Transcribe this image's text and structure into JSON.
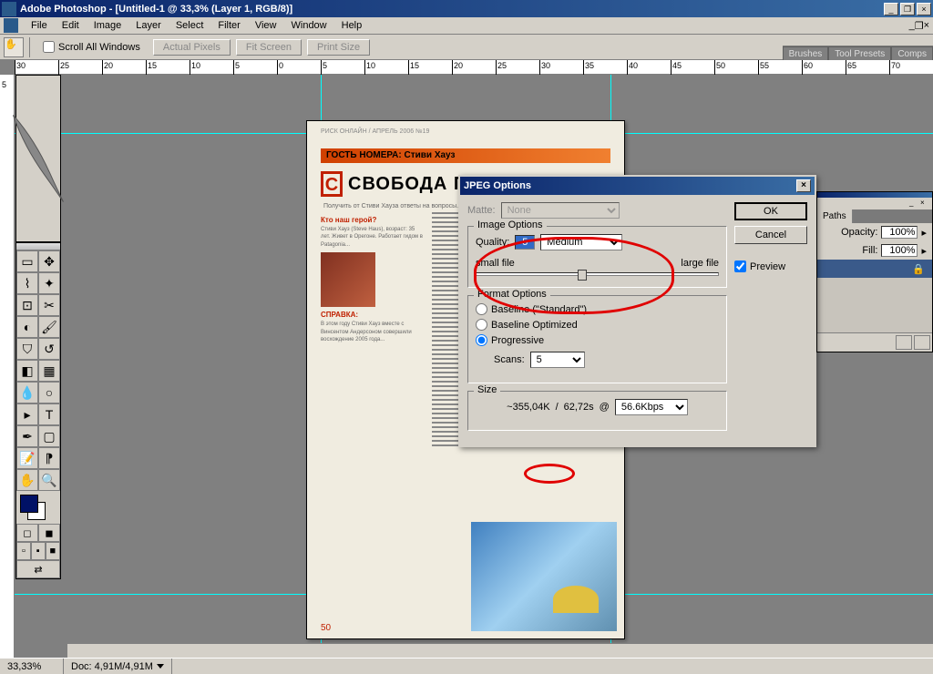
{
  "window": {
    "title": "Adobe Photoshop - [Untitled-1 @ 33,3% (Layer 1, RGB/8)]"
  },
  "menu": {
    "file": "File",
    "edit": "Edit",
    "image": "Image",
    "layer": "Layer",
    "select": "Select",
    "filter": "Filter",
    "view": "View",
    "window": "Window",
    "help": "Help"
  },
  "options": {
    "scroll_all": "Scroll All Windows",
    "actual_pixels": "Actual Pixels",
    "fit_screen": "Fit Screen",
    "print_size": "Print Size"
  },
  "dock_tabs": {
    "brushes": "Brushes",
    "tool_presets": "Tool Presets",
    "comps": "Comps"
  },
  "ruler_marks": [
    "30",
    "25",
    "20",
    "15",
    "10",
    "5",
    "0",
    "5",
    "10",
    "15",
    "20",
    "25",
    "30",
    "35",
    "40",
    "45",
    "50",
    "55",
    "60",
    "65",
    "70"
  ],
  "doc": {
    "strip": "ГОСТЬ НОМЕРА: Стиви Хауз",
    "title": "СВОБОДА ПР",
    "sidebar_hdr1": "Кто наш герой?",
    "sidebar_hdr2": "СПРАВКА:",
    "corner_num": "50"
  },
  "dialog": {
    "title": "JPEG Options",
    "matte_label": "Matte:",
    "matte_value": "None",
    "img_opts": "Image Options",
    "quality_label": "Quality:",
    "quality_value": "5",
    "quality_preset": "Medium",
    "small_file": "small file",
    "large_file": "large file",
    "fmt_opts": "Format Options",
    "baseline_std": "Baseline (\"Standard\")",
    "baseline_opt": "Baseline Optimized",
    "progressive": "Progressive",
    "scans_label": "Scans:",
    "scans_value": "5",
    "size": "Size",
    "size_est": "~355,04K",
    "size_time": "62,72s",
    "at": "@",
    "baud": "56.6Kbps",
    "ok": "OK",
    "cancel": "Cancel",
    "preview": "Preview"
  },
  "panel": {
    "paths": "Paths",
    "opacity_lbl": "Opacity:",
    "opacity_val": "100%",
    "fill_lbl": "Fill:",
    "fill_val": "100%"
  },
  "status": {
    "zoom": "33,33%",
    "doc": "Doc: 4,91M/4,91M"
  }
}
